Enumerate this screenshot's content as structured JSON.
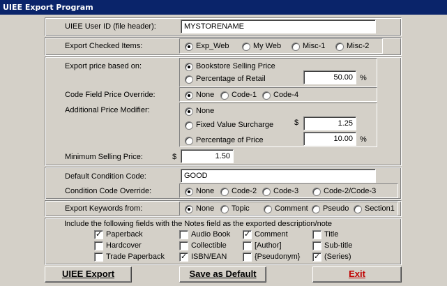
{
  "window": {
    "title": "UIEE Export Program"
  },
  "user_id": {
    "label": "UIEE User ID (file header):",
    "value": "MYSTORENAME"
  },
  "export_checked": {
    "label": "Export Checked Items:",
    "options": [
      "Exp_Web",
      "My Web",
      "Misc-1",
      "Misc-2"
    ],
    "selected": 0
  },
  "export_price": {
    "label": "Export price based on:",
    "options": [
      "Bookstore Selling Price",
      "Percentage of Retail"
    ],
    "selected": 0,
    "percent_value": "50.00",
    "percent_unit": "%"
  },
  "code_override": {
    "label": "Code Field Price Override:",
    "options": [
      "None",
      "Code-1",
      "Code-4"
    ],
    "selected": 0
  },
  "additional_modifier": {
    "label": "Additional Price Modifier:",
    "options": [
      "None",
      "Fixed Value Surcharge",
      "Percentage of Price"
    ],
    "selected": 0,
    "surcharge_currency": "$",
    "surcharge_value": "1.25",
    "percent_value": "10.00",
    "percent_unit": "%"
  },
  "min_price": {
    "label": "Minimum Selling Price:",
    "currency": "$",
    "value": "1.50"
  },
  "default_condition": {
    "label": "Default Condition Code:",
    "value": "GOOD"
  },
  "condition_override": {
    "label": "Condition Code Override:",
    "options": [
      "None",
      "Code-2",
      "Code-3",
      "Code-2/Code-3"
    ],
    "selected": 0
  },
  "keywords": {
    "label": "Export Keywords from:",
    "options": [
      "None",
      "Topic",
      "Comment",
      "Pseudo",
      "Section1"
    ],
    "selected": 0
  },
  "include_fields": {
    "label": "Include the following fields with the Notes field as the exported description/note",
    "items": [
      {
        "label": "Paperback",
        "checked": true
      },
      {
        "label": "Audio Book",
        "checked": false
      },
      {
        "label": "Comment",
        "checked": true
      },
      {
        "label": "Title",
        "checked": false
      },
      {
        "label": "Hardcover",
        "checked": false
      },
      {
        "label": "Collectible",
        "checked": false
      },
      {
        "label": "[Author]",
        "checked": false
      },
      {
        "label": "Sub-title",
        "checked": false
      },
      {
        "label": "Trade Paperback",
        "checked": false
      },
      {
        "label": "ISBN/EAN",
        "checked": true
      },
      {
        "label": "{Pseudonym}",
        "checked": false
      },
      {
        "label": "(Series)",
        "checked": true
      }
    ]
  },
  "buttons": {
    "export": "UIEE Export",
    "save_default": "Save as Default",
    "exit": "Exit"
  }
}
